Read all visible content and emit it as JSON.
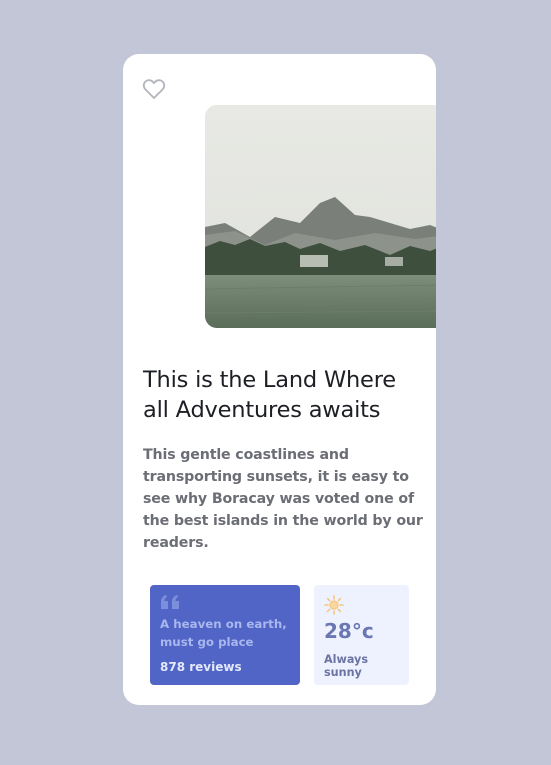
{
  "card": {
    "favorite_icon": "heart-outline-icon",
    "title": "This is the Land Where all Adventures awaits",
    "description": "This gentle coastlines and transporting sunsets, it is easy to see why Boracay was voted one of the best islands in the world by our readers."
  },
  "review": {
    "icon": "quote-icon",
    "text": "A heaven on earth, must go place",
    "count": "878 reviews"
  },
  "weather": {
    "icon": "sun-icon",
    "temperature": "28°c",
    "forecast": "Always sunny"
  },
  "colors": {
    "page_bg": "#c3c6d7",
    "card_bg": "#ffffff",
    "review_bg": "#5065c6",
    "weather_bg": "#eef1fe",
    "sun": "#f5c77e"
  }
}
